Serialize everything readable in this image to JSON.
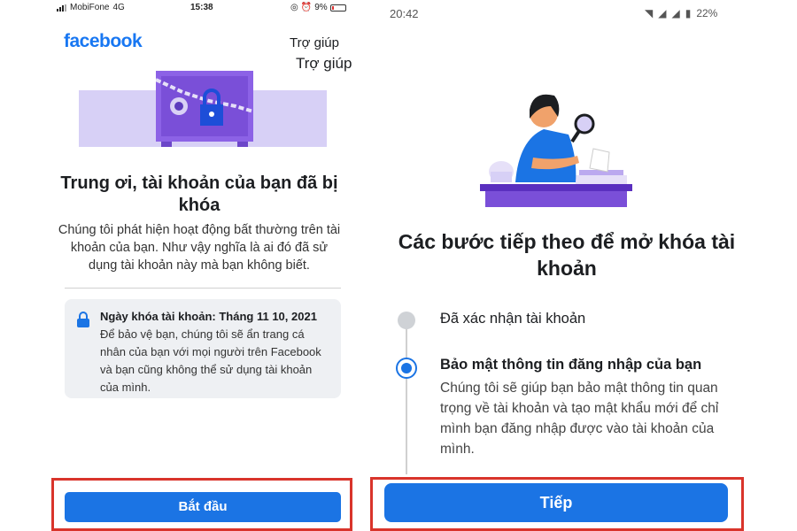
{
  "left": {
    "status_bar": {
      "carrier": "MobiFone",
      "network": "4G",
      "time": "15:38",
      "battery": "9%"
    },
    "logo": "facebook",
    "help": "Trợ giúp",
    "title": "Trung ơi, tài khoản của bạn đã bị khóa",
    "description": "Chúng tôi phát hiện hoạt động bất thường trên tài khoản của bạn. Như vậy nghĩa là ai đó đã sử dụng tài khoản này mà bạn không biết.",
    "info_card": {
      "title": "Ngày khóa tài khoản: Tháng 11 10, 2021",
      "body": "Để bảo vệ bạn, chúng tôi sẽ ẩn trang cá nhân của bạn với mọi người trên Facebook và bạn cũng không thể sử dụng tài khoản của mình."
    },
    "button": "Bắt đầu"
  },
  "right": {
    "status_bar": {
      "time": "20:42",
      "battery": "22%"
    },
    "help": "Trợ giúp",
    "title": "Các bước tiếp theo để mở khóa tài khoản",
    "steps": [
      {
        "label": "Đã xác nhận tài khoản",
        "state": "done"
      },
      {
        "label": "Bảo mật thông tin đăng nhập của bạn",
        "state": "active",
        "description": "Chúng tôi sẽ giúp bạn bảo mật thông tin quan trọng về tài khoản và tạo mật khẩu mới để chỉ mình bạn đăng nhập được vào tài khoản của mình."
      }
    ],
    "button": "Tiếp"
  },
  "colors": {
    "brand": "#1877f2",
    "button": "#1b74e4",
    "highlight_frame": "#d9342b",
    "banner": "#d7d0f6",
    "safe": "#8c62e6"
  }
}
